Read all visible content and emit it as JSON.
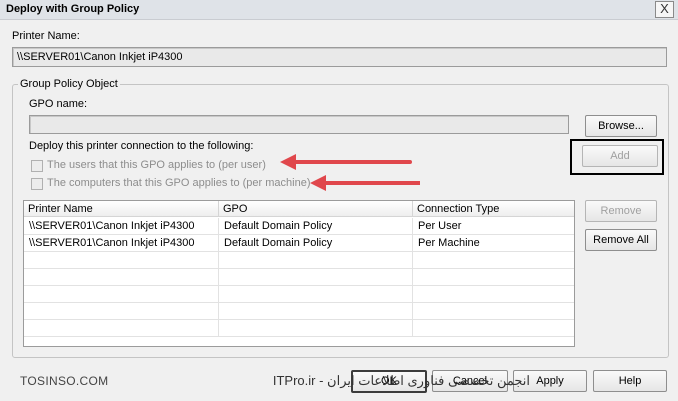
{
  "window": {
    "title": "Deploy with Group Policy",
    "close_label": "X"
  },
  "printer": {
    "label": "Printer Name:",
    "value": "\\\\SERVER01\\Canon Inkjet iP4300"
  },
  "gpo_group": {
    "legend": "Group Policy Object",
    "gpo_name_label": "GPO name:",
    "gpo_name_value": "",
    "browse_label": "Browse...",
    "deploy_label": "Deploy this printer connection to the following:",
    "per_user_label": "The users that this GPO applies to (per user)",
    "per_machine_label": "The computers that this GPO applies to (per machine)",
    "add_label": "Add",
    "remove_label": "Remove",
    "remove_all_label": "Remove All"
  },
  "table": {
    "columns": [
      "Printer Name",
      "GPO",
      "Connection Type"
    ],
    "rows": [
      [
        "\\\\SERVER01\\Canon Inkjet iP4300",
        "Default Domain Policy",
        "Per User"
      ],
      [
        "\\\\SERVER01\\Canon Inkjet iP4300",
        "Default Domain Policy",
        "Per Machine"
      ]
    ]
  },
  "footer": {
    "ok_label": "OK",
    "cancel_label": "Cancel",
    "apply_label": "Apply",
    "help_label": "Help"
  },
  "watermark": {
    "left_text": "TOSINSO.COM",
    "persian_text": "انجمن تخصصی فناوری اطلاعات ایران - ITPro.ir"
  },
  "colors": {
    "arrow": "#e0474c",
    "highlight_box": "#000000"
  }
}
